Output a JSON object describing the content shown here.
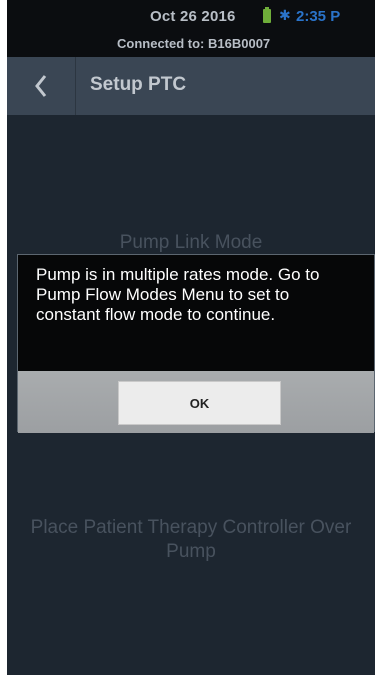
{
  "status_bar": {
    "date": "Oct 26 2016",
    "time": "2:35 P",
    "connected": "Connected to: B16B0007",
    "icons": [
      "battery-icon",
      "bluetooth-icon"
    ]
  },
  "header": {
    "title": "Setup PTC",
    "back_icon": "chevron-left-icon"
  },
  "main": {
    "mode_label": "Pump Link Mode",
    "instruction": "Place Patient Therapy Controller Over Pump"
  },
  "dialog": {
    "message": "Pump is in multiple rates mode. Go to Pump Flow Modes Menu to set to constant flow mode to continue.",
    "ok_label": "OK"
  },
  "colors": {
    "background": "#1d2630",
    "header": "#3a4654",
    "status_bar": "#0b0d10",
    "accent_blue": "#2a73c9",
    "battery_green": "#6fae3a"
  }
}
